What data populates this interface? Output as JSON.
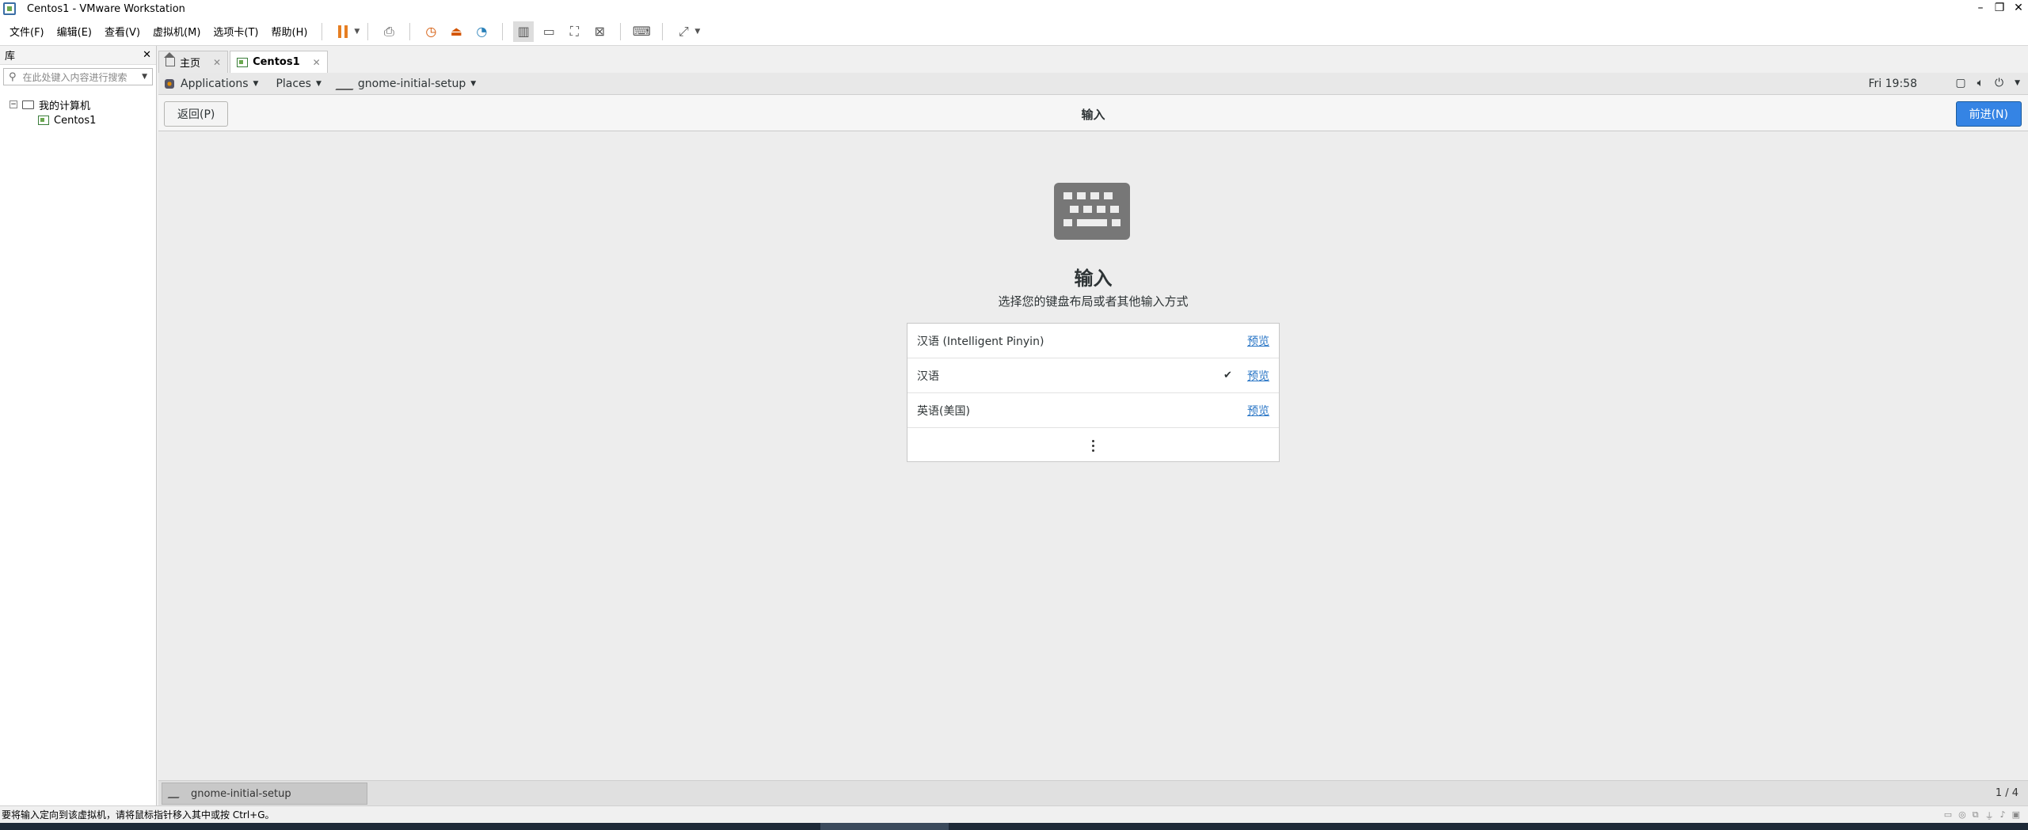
{
  "window": {
    "title": "Centos1 - VMware Workstation",
    "controls": [
      "–",
      "❐",
      "✕"
    ]
  },
  "menu": {
    "items": [
      "文件(F)",
      "编辑(E)",
      "查看(V)",
      "虚拟机(M)",
      "选项卡(T)",
      "帮助(H)"
    ]
  },
  "library": {
    "title": "库",
    "close": "✕",
    "search_placeholder": "在此处键入内容进行搜索",
    "tree_root": "我的计算机",
    "tree_child": "Centos1"
  },
  "tabs": [
    {
      "label": "主页"
    },
    {
      "label": "Centos1"
    }
  ],
  "gnome_top": {
    "applications": "Applications",
    "places": "Places",
    "app": "gnome-initial-setup",
    "clock": "Fri 19:58"
  },
  "header": {
    "back": "返回(P)",
    "title": "输入",
    "next": "前进(N)"
  },
  "page": {
    "title": "输入",
    "subtitle": "选择您的键盘布局或者其他输入方式"
  },
  "input_sources": [
    {
      "name": "汉语 (Intelligent Pinyin)",
      "selected": false,
      "action": "预览"
    },
    {
      "name": "汉语",
      "selected": true,
      "action": "预览"
    },
    {
      "name": "英语(美国)",
      "selected": false,
      "action": "预览"
    }
  ],
  "gnome_bottom": {
    "task": "gnome-initial-setup",
    "workspace": "1 / 4"
  },
  "statusbar": {
    "message": "要将输入定向到该虚拟机，请将鼠标指针移入其中或按 Ctrl+G。"
  }
}
